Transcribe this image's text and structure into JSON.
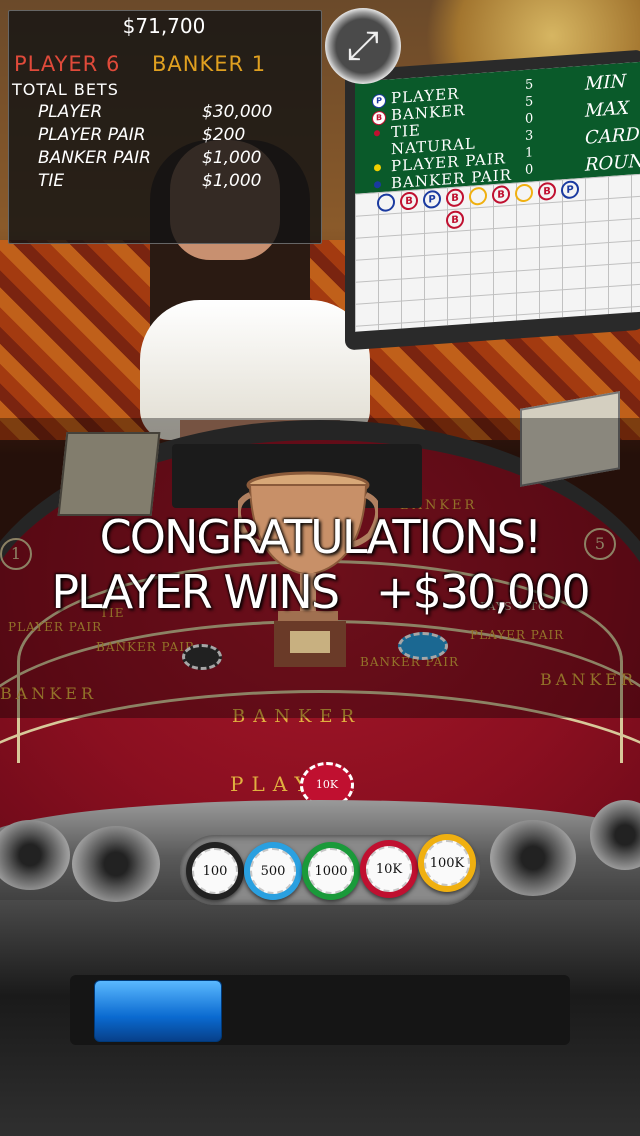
{
  "hud": {
    "balance": "$71,700",
    "player_score": "PLAYER 6",
    "banker_score": "BANKER 1",
    "total_bets_label": "TOTAL BETS",
    "bets": [
      {
        "name": "PLAYER",
        "amount": "$30,000"
      },
      {
        "name": "PLAYER PAIR",
        "amount": "$200"
      },
      {
        "name": "BANKER PAIR",
        "amount": "$1,000"
      },
      {
        "name": "TIE",
        "amount": "$1,000"
      }
    ],
    "expand_icon": "expand-arrows-icon"
  },
  "scoreboard": {
    "rows": [
      {
        "label": "PLAYER",
        "count": "5",
        "marker": "P"
      },
      {
        "label": "BANKER",
        "count": "5",
        "marker": "B"
      },
      {
        "label": "TIE",
        "count": "0",
        "marker": ""
      },
      {
        "label": "NATURAL",
        "count": "3",
        "marker": ""
      },
      {
        "label": "PLAYER PAIR",
        "count": "1",
        "marker": ""
      },
      {
        "label": "BANKER PAIR",
        "count": "0",
        "marker": ""
      }
    ],
    "right_labels": [
      "MIN",
      "MAX",
      "CARD",
      "ROUN"
    ],
    "road_row1": [
      "",
      "B",
      "P",
      "B",
      "",
      "B",
      "",
      "B",
      "P"
    ],
    "road_row2": [
      "B"
    ]
  },
  "message": {
    "line1": "CONGRATULATIONS!",
    "line2": "PLAYER WINS   +$30,000"
  },
  "table_labels": {
    "banker_top": "BANKER",
    "pays": "PAYS 1 TO",
    "banker": "BANKER",
    "player": "PLAYER",
    "player_pair": "PLAYER PAIR",
    "banker_pair": "BANKER PAIR",
    "tie": "TIE",
    "seat_1": "1",
    "seat_5": "5",
    "bet_chip": "10K"
  },
  "chips": [
    {
      "label": "100",
      "color": "#222222"
    },
    {
      "label": "500",
      "color": "#2aa0e0"
    },
    {
      "label": "1000",
      "color": "#1a9a3a"
    },
    {
      "label": "10K",
      "color": "#c01030"
    },
    {
      "label": "100K",
      "color": "#f0b010"
    }
  ]
}
